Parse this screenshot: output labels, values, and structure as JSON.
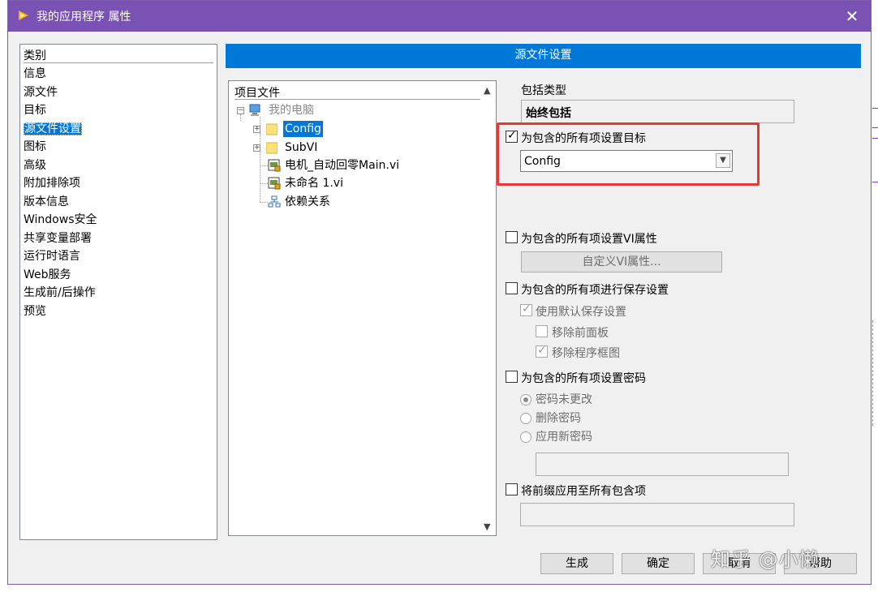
{
  "window": {
    "title": "我的应用程序 属性",
    "accent_color": "#7a52b3",
    "close_icon": "close-icon"
  },
  "category": {
    "header": "类别",
    "items": [
      "信息",
      "源文件",
      "目标",
      "源文件设置",
      "图标",
      "高级",
      "附加排除项",
      "版本信息",
      "Windows安全",
      "共享变量部署",
      "运行时语言",
      "Web服务",
      "生成前/后操作",
      "预览"
    ],
    "selected_index": 3
  },
  "section": {
    "title": "源文件设置",
    "color": "#0078d7"
  },
  "tree": {
    "header": "项目文件",
    "root": "我的电脑",
    "items": [
      "Config",
      "SubVI",
      "电机_自动回零Main.vi",
      "未命名 1.vi",
      "依赖关系"
    ]
  },
  "settings": {
    "include_type_label": "包括类型",
    "include_type_value": "始终包括",
    "set_destination_label": "为包含的所有项设置目标",
    "set_destination_checked": true,
    "destination_value": "Config",
    "set_vi_props_label": "为包含的所有项设置VI属性",
    "set_vi_props_checked": false,
    "custom_vi_props_button": "自定义VI属性...",
    "save_settings_label": "为包含的所有项进行保存设置",
    "save_settings_checked": false,
    "use_default_save_label": "使用默认保存设置",
    "use_default_save_checked": true,
    "remove_front_panel_label": "移除前面板",
    "remove_front_panel_checked": false,
    "remove_block_diagram_label": "移除程序框图",
    "remove_block_diagram_checked": true,
    "set_password_label": "为包含的所有项设置密码",
    "set_password_checked": false,
    "password_options": [
      "密码未更改",
      "删除密码",
      "应用新密码"
    ],
    "password_selected_index": 0,
    "password_value": "",
    "apply_prefix_label": "将前缀应用至所有包含项",
    "apply_prefix_checked": false,
    "prefix_value": ""
  },
  "buttons": {
    "build": "生成",
    "ok": "确定",
    "cancel": "取消",
    "help": "帮助"
  },
  "watermark": "知乎 @小懒",
  "highlight_color": "#e53935"
}
